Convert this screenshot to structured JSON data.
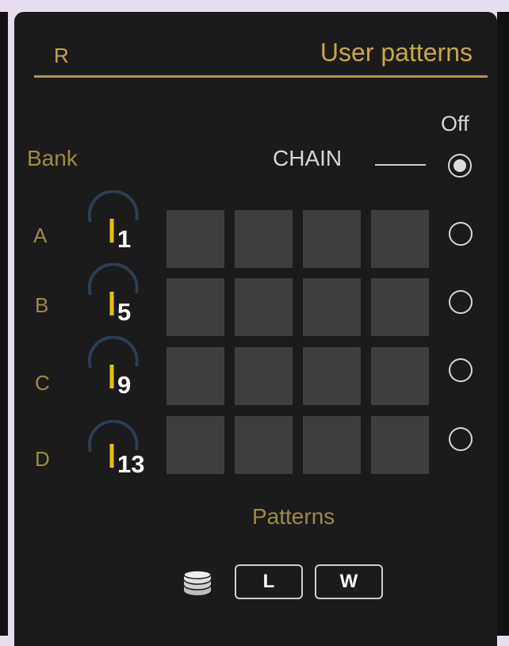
{
  "header": {
    "left_label": "R",
    "title": "User patterns"
  },
  "labels": {
    "bank": "Bank",
    "off": "Off",
    "chain": "CHAIN",
    "patterns": "Patterns"
  },
  "rows": [
    {
      "letter": "A",
      "knob_value": "1"
    },
    {
      "letter": "B",
      "knob_value": "5"
    },
    {
      "letter": "C",
      "knob_value": "9"
    },
    {
      "letter": "D",
      "knob_value": "13"
    }
  ],
  "selected_radio": "chain",
  "buttons": {
    "load": "L",
    "write": "W"
  },
  "icons": {
    "storage": "stack-icon"
  },
  "colors": {
    "accent": "#c9a93b",
    "panel": "#1b1b1c",
    "pad": "#3e3e3e",
    "knob_arc": "#2c3e52"
  }
}
